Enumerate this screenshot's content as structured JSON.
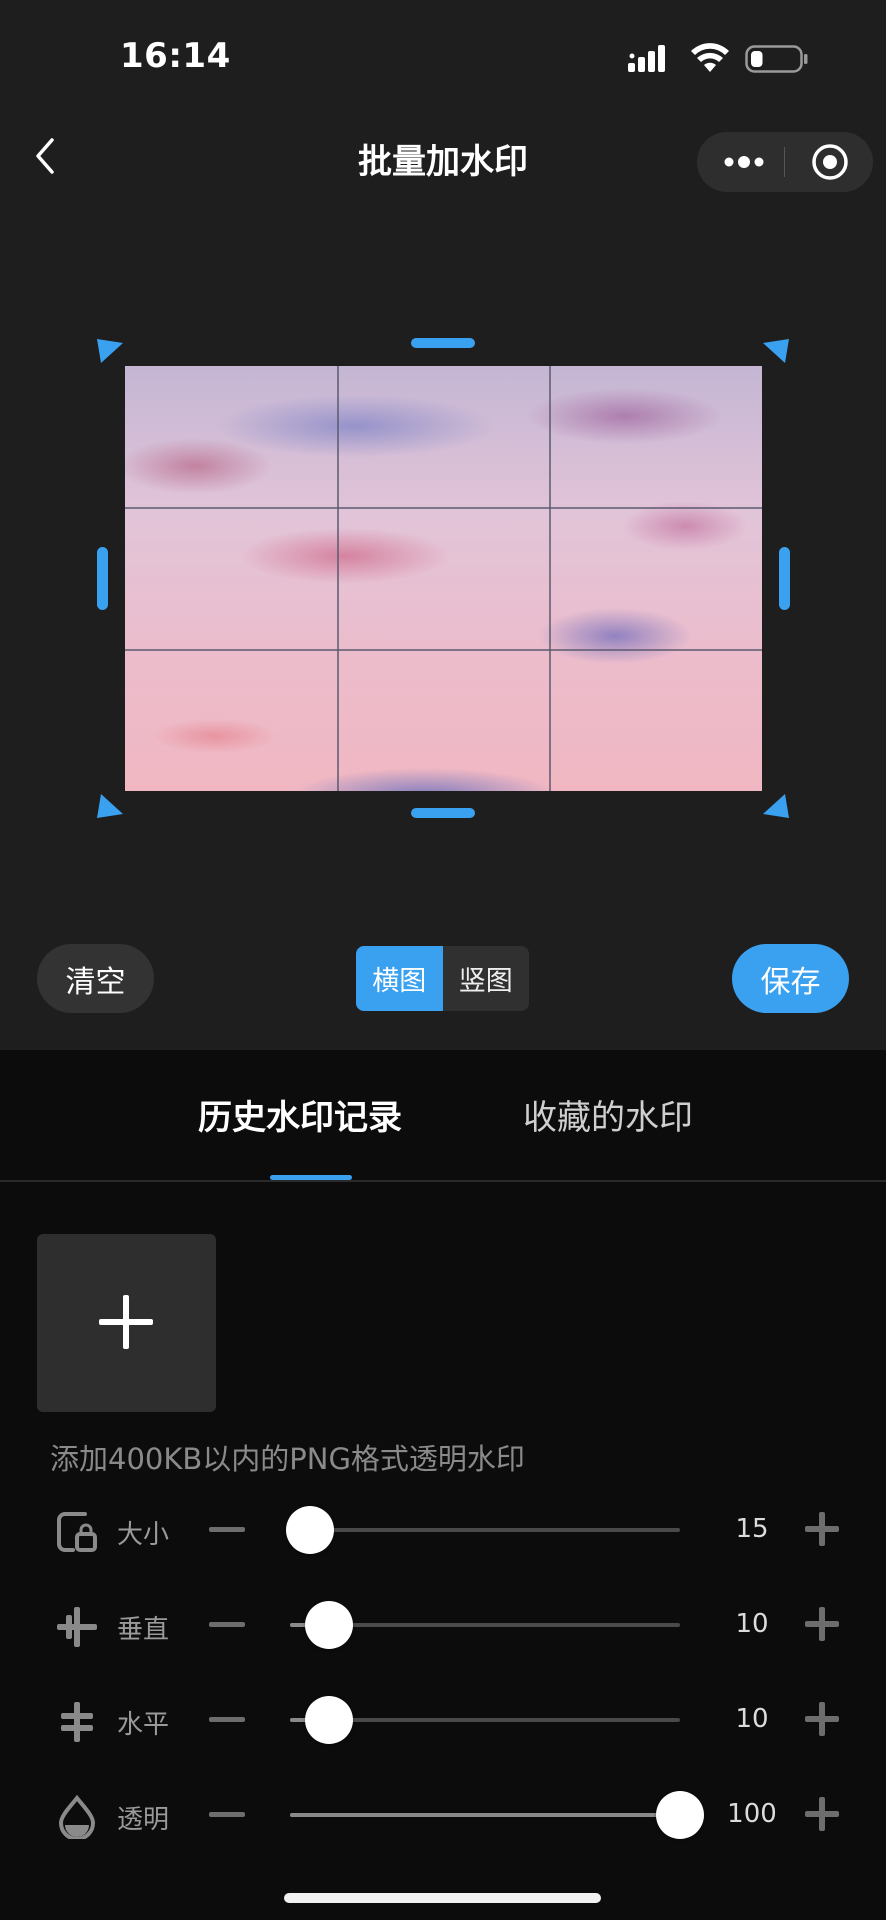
{
  "status_bar": {
    "time": "16:14",
    "battery_level": 0.25
  },
  "nav": {
    "title": "批量加水印",
    "back_icon": "chevron-left-icon",
    "more_icon": "more-dots-icon",
    "close_icon": "target-close-icon"
  },
  "canvas": {
    "grid": "3x3",
    "handle_color": "#3aa1f0"
  },
  "toolbar": {
    "clear_label": "清空",
    "orientation_options": [
      "横图",
      "竖图"
    ],
    "selected_orientation": "横图",
    "save_label": "保存"
  },
  "tabs": [
    {
      "label": "历史水印记录",
      "active": true
    },
    {
      "label": "收藏的水印",
      "active": false
    }
  ],
  "add_watermark": {
    "icon": "plus-icon",
    "hint": "添加400KB以内的PNG格式透明水印"
  },
  "sliders": [
    {
      "key": "size",
      "label": "大小",
      "icon": "size-lock-icon",
      "value": "15",
      "fraction": 0.05
    },
    {
      "key": "vertical",
      "label": "垂直",
      "icon": "vertical-cross-icon",
      "value": "10",
      "fraction": 0.1
    },
    {
      "key": "horizontal",
      "label": "水平",
      "icon": "horizontal-cross-icon",
      "value": "10",
      "fraction": 0.1
    },
    {
      "key": "opacity",
      "label": "透明",
      "icon": "droplet-icon",
      "value": "100",
      "fraction": 1.0
    }
  ],
  "colors": {
    "accent": "#3aa1f0",
    "panel_bg": "#1e1e1e",
    "page_bg": "#0c0c0c"
  }
}
